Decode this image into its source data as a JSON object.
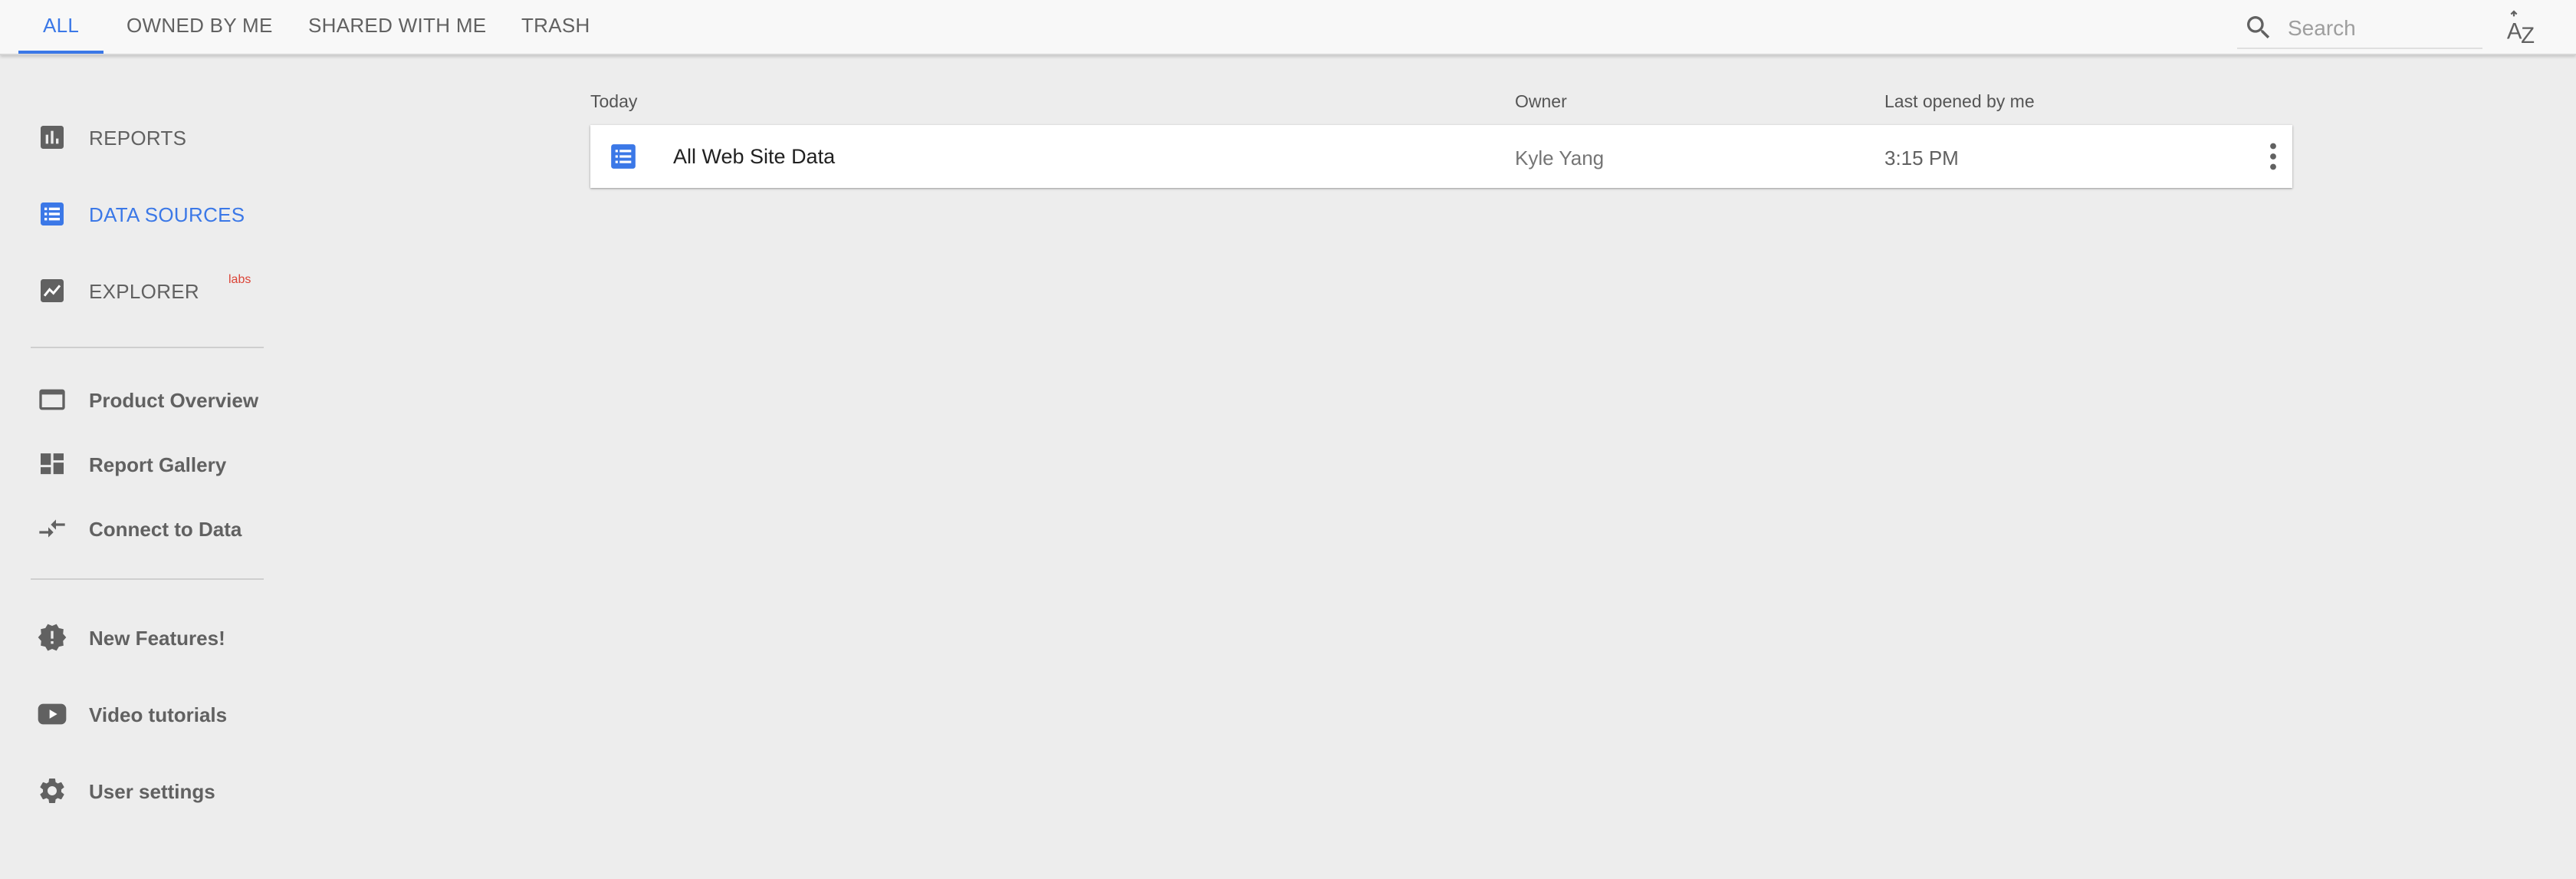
{
  "tabs": [
    {
      "label": "ALL",
      "active": true
    },
    {
      "label": "OWNED BY ME",
      "active": false
    },
    {
      "label": "SHARED WITH ME",
      "active": false
    },
    {
      "label": "TRASH",
      "active": false
    }
  ],
  "search": {
    "placeholder": "Search",
    "value": ""
  },
  "sort": {
    "icon": "sort-az-icon"
  },
  "sidebar": {
    "primary": [
      {
        "label": "REPORTS",
        "icon": "bar-chart-icon",
        "selected": false
      },
      {
        "label": "DATA SOURCES",
        "icon": "list-icon",
        "selected": true
      },
      {
        "label": "EXPLORER",
        "icon": "trending-chart-icon",
        "selected": false,
        "badge": "labs"
      }
    ],
    "secondary": [
      {
        "label": "Product Overview",
        "icon": "window-icon"
      },
      {
        "label": "Report Gallery",
        "icon": "dashboard-icon"
      },
      {
        "label": "Connect to Data",
        "icon": "compare-arrows-icon"
      }
    ],
    "tertiary": [
      {
        "label": "New Features!",
        "icon": "new-releases-icon"
      },
      {
        "label": "Video tutorials",
        "icon": "video-icon"
      },
      {
        "label": "User settings",
        "icon": "gear-icon"
      }
    ]
  },
  "table": {
    "headers": {
      "name": "Today",
      "owner": "Owner",
      "last_opened": "Last opened by me"
    },
    "rows": [
      {
        "name": "All Web Site Data",
        "owner": "Kyle Yang",
        "last_opened": "3:15 PM",
        "icon": "list-icon"
      }
    ]
  },
  "colors": {
    "accent": "#3b78e7",
    "labs_badge": "#db4437",
    "background": "#ededed",
    "topbar": "#f8f8f8"
  }
}
